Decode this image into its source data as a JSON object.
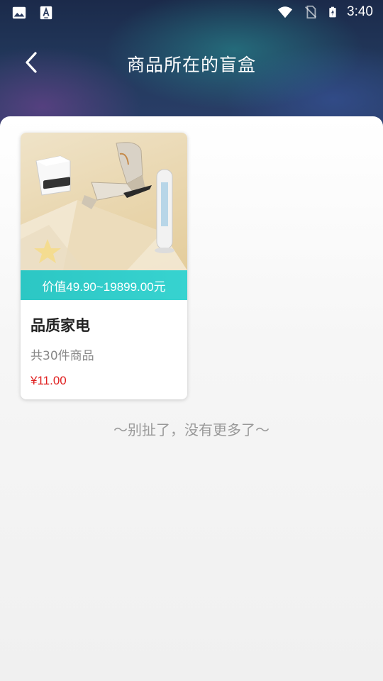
{
  "status_bar": {
    "time": "3:40",
    "icons": [
      "image-icon",
      "font-download-icon",
      "wifi-icon",
      "no-sim-icon",
      "battery-charging-icon"
    ]
  },
  "nav": {
    "title": "商品所在的盲盒",
    "back_icon": "chevron-left-icon"
  },
  "card": {
    "image_desc_icons": [
      "robot-vacuum-icon",
      "massage-chair-icon",
      "tower-fan-icon"
    ],
    "value_range": "价值49.90~19899.00元",
    "name": "品质家电",
    "count": "共30件商品",
    "price": "¥11.00"
  },
  "footer": {
    "end_text": "～别扯了，没有更多了～"
  },
  "colors": {
    "accent_teal": "#2cc7c4",
    "price_red": "#e02020"
  }
}
